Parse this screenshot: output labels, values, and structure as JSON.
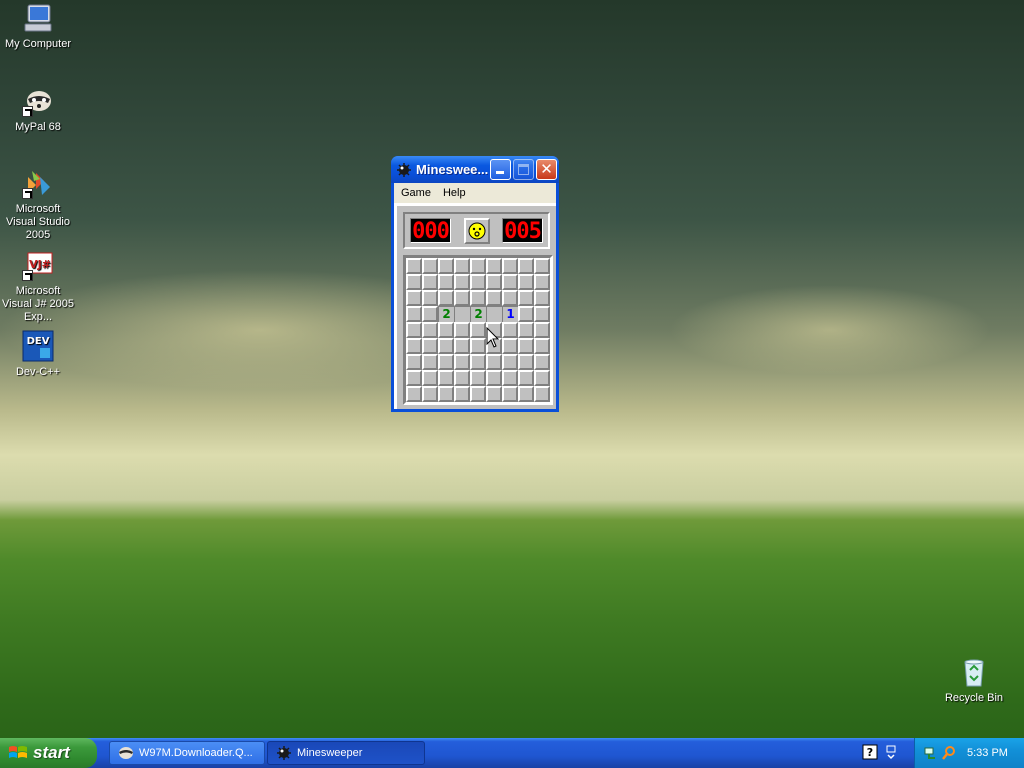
{
  "desktop": {
    "icons": [
      {
        "label": "My Computer",
        "icon": "computer-icon"
      },
      {
        "label": "MyPal 68",
        "icon": "raccoon-icon"
      },
      {
        "label": "Microsoft Visual Studio 2005",
        "icon": "visual-studio-icon"
      },
      {
        "label": "Microsoft Visual J# 2005 Exp...",
        "icon": "vj-icon"
      },
      {
        "label": "Dev-C++",
        "icon": "devcpp-icon"
      },
      {
        "label": "Recycle Bin",
        "icon": "recycle-bin-icon"
      }
    ]
  },
  "window": {
    "title": "Mineswee...",
    "menu": [
      "Game",
      "Help"
    ],
    "mine_counter": "000",
    "timer": "005",
    "face": "smiley-face-icon",
    "grid": {
      "rows": 9,
      "cols": 9,
      "open_cells": [
        {
          "row": 3,
          "col": 2,
          "value": "2"
        },
        {
          "row": 3,
          "col": 3,
          "value": ""
        },
        {
          "row": 3,
          "col": 4,
          "value": "2"
        },
        {
          "row": 3,
          "col": 5,
          "value": ""
        },
        {
          "row": 3,
          "col": 6,
          "value": "1"
        }
      ]
    }
  },
  "taskbar": {
    "start_label": "start",
    "tasks": [
      {
        "label": "W97M.Downloader.Q...",
        "active": false
      },
      {
        "label": "Minesweeper",
        "active": true
      }
    ],
    "clock": "5:33 PM"
  },
  "colors": {
    "title_blue": "#0a4fd8",
    "taskbar_blue": "#245edb",
    "start_green": "#3c9a3c",
    "led_red": "#ff0000"
  }
}
